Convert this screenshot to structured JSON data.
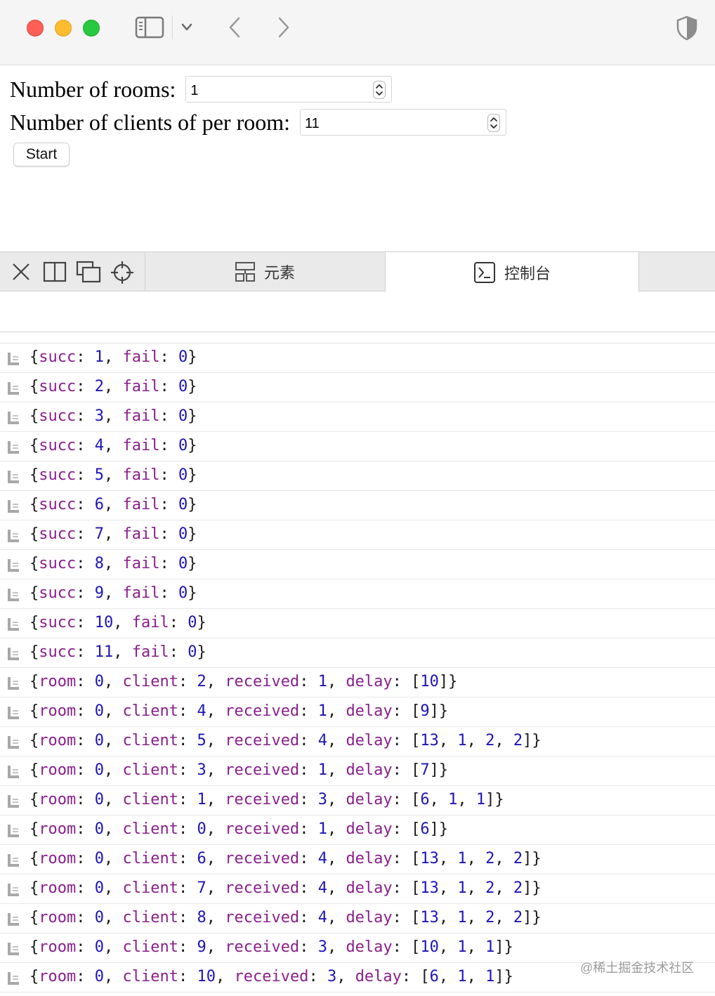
{
  "browser": {
    "icons": [
      "close-window",
      "minimize-window",
      "zoom-window",
      "sidebar-icon",
      "chevron-down-icon",
      "back-icon",
      "forward-icon",
      "shield-icon"
    ]
  },
  "form": {
    "rooms_label": "Number of rooms:",
    "rooms_value": "1",
    "clients_label": "Number of clients of per room:",
    "clients_value": "11",
    "start_label": "Start"
  },
  "devtools": {
    "tabs": [
      {
        "label": "元素",
        "icon": "elements-icon",
        "active": false
      },
      {
        "label": "控制台",
        "icon": "console-icon",
        "active": true
      }
    ]
  },
  "console": {
    "logs": [
      [
        [
          "p",
          "{"
        ],
        [
          "k",
          "succ"
        ],
        [
          "p",
          ": "
        ],
        [
          "n",
          "1"
        ],
        [
          "p",
          ", "
        ],
        [
          "k",
          "fail"
        ],
        [
          "p",
          ": "
        ],
        [
          "n",
          "0"
        ],
        [
          "p",
          "}"
        ]
      ],
      [
        [
          "p",
          "{"
        ],
        [
          "k",
          "succ"
        ],
        [
          "p",
          ": "
        ],
        [
          "n",
          "2"
        ],
        [
          "p",
          ", "
        ],
        [
          "k",
          "fail"
        ],
        [
          "p",
          ": "
        ],
        [
          "n",
          "0"
        ],
        [
          "p",
          "}"
        ]
      ],
      [
        [
          "p",
          "{"
        ],
        [
          "k",
          "succ"
        ],
        [
          "p",
          ": "
        ],
        [
          "n",
          "3"
        ],
        [
          "p",
          ", "
        ],
        [
          "k",
          "fail"
        ],
        [
          "p",
          ": "
        ],
        [
          "n",
          "0"
        ],
        [
          "p",
          "}"
        ]
      ],
      [
        [
          "p",
          "{"
        ],
        [
          "k",
          "succ"
        ],
        [
          "p",
          ": "
        ],
        [
          "n",
          "4"
        ],
        [
          "p",
          ", "
        ],
        [
          "k",
          "fail"
        ],
        [
          "p",
          ": "
        ],
        [
          "n",
          "0"
        ],
        [
          "p",
          "}"
        ]
      ],
      [
        [
          "p",
          "{"
        ],
        [
          "k",
          "succ"
        ],
        [
          "p",
          ": "
        ],
        [
          "n",
          "5"
        ],
        [
          "p",
          ", "
        ],
        [
          "k",
          "fail"
        ],
        [
          "p",
          ": "
        ],
        [
          "n",
          "0"
        ],
        [
          "p",
          "}"
        ]
      ],
      [
        [
          "p",
          "{"
        ],
        [
          "k",
          "succ"
        ],
        [
          "p",
          ": "
        ],
        [
          "n",
          "6"
        ],
        [
          "p",
          ", "
        ],
        [
          "k",
          "fail"
        ],
        [
          "p",
          ": "
        ],
        [
          "n",
          "0"
        ],
        [
          "p",
          "}"
        ]
      ],
      [
        [
          "p",
          "{"
        ],
        [
          "k",
          "succ"
        ],
        [
          "p",
          ": "
        ],
        [
          "n",
          "7"
        ],
        [
          "p",
          ", "
        ],
        [
          "k",
          "fail"
        ],
        [
          "p",
          ": "
        ],
        [
          "n",
          "0"
        ],
        [
          "p",
          "}"
        ]
      ],
      [
        [
          "p",
          "{"
        ],
        [
          "k",
          "succ"
        ],
        [
          "p",
          ": "
        ],
        [
          "n",
          "8"
        ],
        [
          "p",
          ", "
        ],
        [
          "k",
          "fail"
        ],
        [
          "p",
          ": "
        ],
        [
          "n",
          "0"
        ],
        [
          "p",
          "}"
        ]
      ],
      [
        [
          "p",
          "{"
        ],
        [
          "k",
          "succ"
        ],
        [
          "p",
          ": "
        ],
        [
          "n",
          "9"
        ],
        [
          "p",
          ", "
        ],
        [
          "k",
          "fail"
        ],
        [
          "p",
          ": "
        ],
        [
          "n",
          "0"
        ],
        [
          "p",
          "}"
        ]
      ],
      [
        [
          "p",
          "{"
        ],
        [
          "k",
          "succ"
        ],
        [
          "p",
          ": "
        ],
        [
          "n",
          "10"
        ],
        [
          "p",
          ", "
        ],
        [
          "k",
          "fail"
        ],
        [
          "p",
          ": "
        ],
        [
          "n",
          "0"
        ],
        [
          "p",
          "}"
        ]
      ],
      [
        [
          "p",
          "{"
        ],
        [
          "k",
          "succ"
        ],
        [
          "p",
          ": "
        ],
        [
          "n",
          "11"
        ],
        [
          "p",
          ", "
        ],
        [
          "k",
          "fail"
        ],
        [
          "p",
          ": "
        ],
        [
          "n",
          "0"
        ],
        [
          "p",
          "}"
        ]
      ],
      [
        [
          "p",
          "{"
        ],
        [
          "k",
          "room"
        ],
        [
          "p",
          ": "
        ],
        [
          "n",
          "0"
        ],
        [
          "p",
          ", "
        ],
        [
          "k",
          "client"
        ],
        [
          "p",
          ": "
        ],
        [
          "n",
          "2"
        ],
        [
          "p",
          ", "
        ],
        [
          "k",
          "received"
        ],
        [
          "p",
          ": "
        ],
        [
          "n",
          "1"
        ],
        [
          "p",
          ", "
        ],
        [
          "k",
          "delay"
        ],
        [
          "p",
          ": ["
        ],
        [
          "n",
          "10"
        ],
        [
          "p",
          "]}"
        ]
      ],
      [
        [
          "p",
          "{"
        ],
        [
          "k",
          "room"
        ],
        [
          "p",
          ": "
        ],
        [
          "n",
          "0"
        ],
        [
          "p",
          ", "
        ],
        [
          "k",
          "client"
        ],
        [
          "p",
          ": "
        ],
        [
          "n",
          "4"
        ],
        [
          "p",
          ", "
        ],
        [
          "k",
          "received"
        ],
        [
          "p",
          ": "
        ],
        [
          "n",
          "1"
        ],
        [
          "p",
          ", "
        ],
        [
          "k",
          "delay"
        ],
        [
          "p",
          ": ["
        ],
        [
          "n",
          "9"
        ],
        [
          "p",
          "]}"
        ]
      ],
      [
        [
          "p",
          "{"
        ],
        [
          "k",
          "room"
        ],
        [
          "p",
          ": "
        ],
        [
          "n",
          "0"
        ],
        [
          "p",
          ", "
        ],
        [
          "k",
          "client"
        ],
        [
          "p",
          ": "
        ],
        [
          "n",
          "5"
        ],
        [
          "p",
          ", "
        ],
        [
          "k",
          "received"
        ],
        [
          "p",
          ": "
        ],
        [
          "n",
          "4"
        ],
        [
          "p",
          ", "
        ],
        [
          "k",
          "delay"
        ],
        [
          "p",
          ": ["
        ],
        [
          "n",
          "13"
        ],
        [
          "p",
          ", "
        ],
        [
          "n",
          "1"
        ],
        [
          "p",
          ", "
        ],
        [
          "n",
          "2"
        ],
        [
          "p",
          ", "
        ],
        [
          "n",
          "2"
        ],
        [
          "p",
          "]}"
        ]
      ],
      [
        [
          "p",
          "{"
        ],
        [
          "k",
          "room"
        ],
        [
          "p",
          ": "
        ],
        [
          "n",
          "0"
        ],
        [
          "p",
          ", "
        ],
        [
          "k",
          "client"
        ],
        [
          "p",
          ": "
        ],
        [
          "n",
          "3"
        ],
        [
          "p",
          ", "
        ],
        [
          "k",
          "received"
        ],
        [
          "p",
          ": "
        ],
        [
          "n",
          "1"
        ],
        [
          "p",
          ", "
        ],
        [
          "k",
          "delay"
        ],
        [
          "p",
          ": ["
        ],
        [
          "n",
          "7"
        ],
        [
          "p",
          "]}"
        ]
      ],
      [
        [
          "p",
          "{"
        ],
        [
          "k",
          "room"
        ],
        [
          "p",
          ": "
        ],
        [
          "n",
          "0"
        ],
        [
          "p",
          ", "
        ],
        [
          "k",
          "client"
        ],
        [
          "p",
          ": "
        ],
        [
          "n",
          "1"
        ],
        [
          "p",
          ", "
        ],
        [
          "k",
          "received"
        ],
        [
          "p",
          ": "
        ],
        [
          "n",
          "3"
        ],
        [
          "p",
          ", "
        ],
        [
          "k",
          "delay"
        ],
        [
          "p",
          ": ["
        ],
        [
          "n",
          "6"
        ],
        [
          "p",
          ", "
        ],
        [
          "n",
          "1"
        ],
        [
          "p",
          ", "
        ],
        [
          "n",
          "1"
        ],
        [
          "p",
          "]}"
        ]
      ],
      [
        [
          "p",
          "{"
        ],
        [
          "k",
          "room"
        ],
        [
          "p",
          ": "
        ],
        [
          "n",
          "0"
        ],
        [
          "p",
          ", "
        ],
        [
          "k",
          "client"
        ],
        [
          "p",
          ": "
        ],
        [
          "n",
          "0"
        ],
        [
          "p",
          ", "
        ],
        [
          "k",
          "received"
        ],
        [
          "p",
          ": "
        ],
        [
          "n",
          "1"
        ],
        [
          "p",
          ", "
        ],
        [
          "k",
          "delay"
        ],
        [
          "p",
          ": ["
        ],
        [
          "n",
          "6"
        ],
        [
          "p",
          "]}"
        ]
      ],
      [
        [
          "p",
          "{"
        ],
        [
          "k",
          "room"
        ],
        [
          "p",
          ": "
        ],
        [
          "n",
          "0"
        ],
        [
          "p",
          ", "
        ],
        [
          "k",
          "client"
        ],
        [
          "p",
          ": "
        ],
        [
          "n",
          "6"
        ],
        [
          "p",
          ", "
        ],
        [
          "k",
          "received"
        ],
        [
          "p",
          ": "
        ],
        [
          "n",
          "4"
        ],
        [
          "p",
          ", "
        ],
        [
          "k",
          "delay"
        ],
        [
          "p",
          ": ["
        ],
        [
          "n",
          "13"
        ],
        [
          "p",
          ", "
        ],
        [
          "n",
          "1"
        ],
        [
          "p",
          ", "
        ],
        [
          "n",
          "2"
        ],
        [
          "p",
          ", "
        ],
        [
          "n",
          "2"
        ],
        [
          "p",
          "]}"
        ]
      ],
      [
        [
          "p",
          "{"
        ],
        [
          "k",
          "room"
        ],
        [
          "p",
          ": "
        ],
        [
          "n",
          "0"
        ],
        [
          "p",
          ", "
        ],
        [
          "k",
          "client"
        ],
        [
          "p",
          ": "
        ],
        [
          "n",
          "7"
        ],
        [
          "p",
          ", "
        ],
        [
          "k",
          "received"
        ],
        [
          "p",
          ": "
        ],
        [
          "n",
          "4"
        ],
        [
          "p",
          ", "
        ],
        [
          "k",
          "delay"
        ],
        [
          "p",
          ": ["
        ],
        [
          "n",
          "13"
        ],
        [
          "p",
          ", "
        ],
        [
          "n",
          "1"
        ],
        [
          "p",
          ", "
        ],
        [
          "n",
          "2"
        ],
        [
          "p",
          ", "
        ],
        [
          "n",
          "2"
        ],
        [
          "p",
          "]}"
        ]
      ],
      [
        [
          "p",
          "{"
        ],
        [
          "k",
          "room"
        ],
        [
          "p",
          ": "
        ],
        [
          "n",
          "0"
        ],
        [
          "p",
          ", "
        ],
        [
          "k",
          "client"
        ],
        [
          "p",
          ": "
        ],
        [
          "n",
          "8"
        ],
        [
          "p",
          ", "
        ],
        [
          "k",
          "received"
        ],
        [
          "p",
          ": "
        ],
        [
          "n",
          "4"
        ],
        [
          "p",
          ", "
        ],
        [
          "k",
          "delay"
        ],
        [
          "p",
          ": ["
        ],
        [
          "n",
          "13"
        ],
        [
          "p",
          ", "
        ],
        [
          "n",
          "1"
        ],
        [
          "p",
          ", "
        ],
        [
          "n",
          "2"
        ],
        [
          "p",
          ", "
        ],
        [
          "n",
          "2"
        ],
        [
          "p",
          "]}"
        ]
      ],
      [
        [
          "p",
          "{"
        ],
        [
          "k",
          "room"
        ],
        [
          "p",
          ": "
        ],
        [
          "n",
          "0"
        ],
        [
          "p",
          ", "
        ],
        [
          "k",
          "client"
        ],
        [
          "p",
          ": "
        ],
        [
          "n",
          "9"
        ],
        [
          "p",
          ", "
        ],
        [
          "k",
          "received"
        ],
        [
          "p",
          ": "
        ],
        [
          "n",
          "3"
        ],
        [
          "p",
          ", "
        ],
        [
          "k",
          "delay"
        ],
        [
          "p",
          ": ["
        ],
        [
          "n",
          "10"
        ],
        [
          "p",
          ", "
        ],
        [
          "n",
          "1"
        ],
        [
          "p",
          ", "
        ],
        [
          "n",
          "1"
        ],
        [
          "p",
          "]}"
        ]
      ],
      [
        [
          "p",
          "{"
        ],
        [
          "k",
          "room"
        ],
        [
          "p",
          ": "
        ],
        [
          "n",
          "0"
        ],
        [
          "p",
          ", "
        ],
        [
          "k",
          "client"
        ],
        [
          "p",
          ": "
        ],
        [
          "n",
          "10"
        ],
        [
          "p",
          ", "
        ],
        [
          "k",
          "received"
        ],
        [
          "p",
          ": "
        ],
        [
          "n",
          "3"
        ],
        [
          "p",
          ", "
        ],
        [
          "k",
          "delay"
        ],
        [
          "p",
          ": ["
        ],
        [
          "n",
          "6"
        ],
        [
          "p",
          ", "
        ],
        [
          "n",
          "1"
        ],
        [
          "p",
          ", "
        ],
        [
          "n",
          "1"
        ],
        [
          "p",
          "]}"
        ]
      ]
    ]
  },
  "watermark": "@稀土掘金技术社区",
  "colors": {
    "key": "#8a1f8c",
    "number": "#1d14b8",
    "punct": "#1a1a1a"
  }
}
